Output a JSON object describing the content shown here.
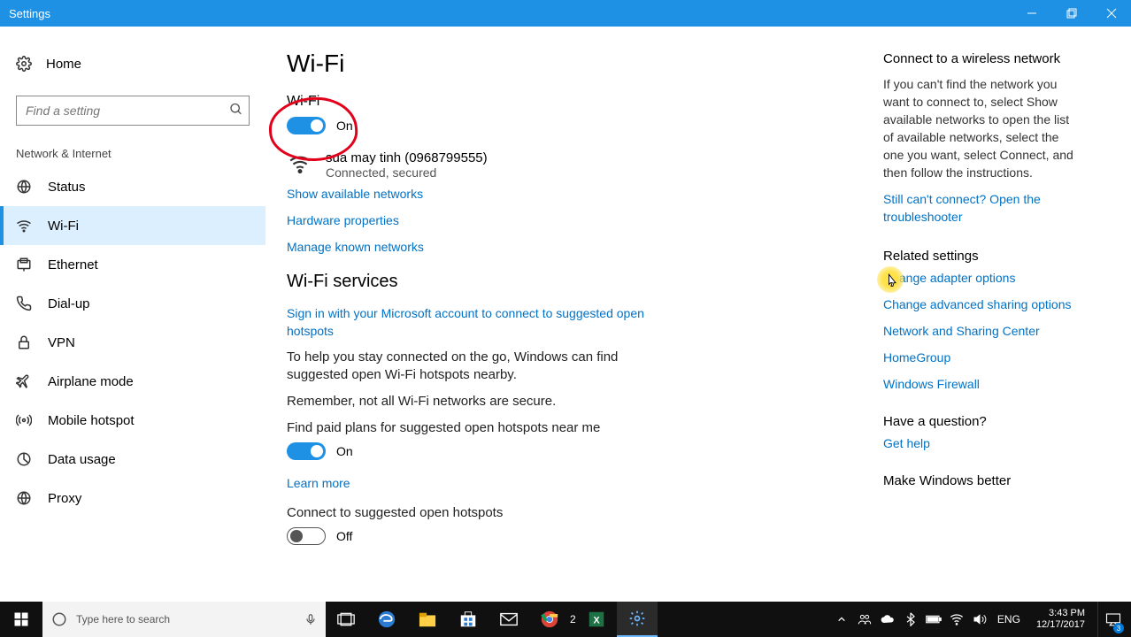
{
  "window": {
    "title": "Settings"
  },
  "sidebar": {
    "home": "Home",
    "search_placeholder": "Find a setting",
    "section": "Network & Internet",
    "items": [
      {
        "id": "status",
        "label": "Status",
        "icon": "status-icon"
      },
      {
        "id": "wifi",
        "label": "Wi-Fi",
        "icon": "wifi-icon",
        "selected": true
      },
      {
        "id": "ethernet",
        "label": "Ethernet",
        "icon": "ethernet-icon"
      },
      {
        "id": "dialup",
        "label": "Dial-up",
        "icon": "dialup-icon"
      },
      {
        "id": "vpn",
        "label": "VPN",
        "icon": "vpn-icon"
      },
      {
        "id": "airplane",
        "label": "Airplane mode",
        "icon": "airplane-icon"
      },
      {
        "id": "hotspot",
        "label": "Mobile hotspot",
        "icon": "hotspot-icon"
      },
      {
        "id": "datausage",
        "label": "Data usage",
        "icon": "datausage-icon"
      },
      {
        "id": "proxy",
        "label": "Proxy",
        "icon": "proxy-icon"
      }
    ]
  },
  "content": {
    "page_title": "Wi-Fi",
    "wifi_label": "Wi-Fi",
    "wifi_state": "On",
    "network_name": "sua may tinh (0968799555)",
    "network_status": "Connected, secured",
    "link_show_networks": "Show available networks",
    "link_hw_props": "Hardware properties",
    "link_manage_known": "Manage known networks",
    "services_heading": "Wi-Fi services",
    "link_signin": "Sign in with your Microsoft account to connect to suggested open hotspots",
    "para_help": "To help you stay connected on the go, Windows can find suggested open Wi-Fi hotspots nearby.",
    "para_remember": "Remember, not all Wi-Fi networks are secure.",
    "paid_plans_label": "Find paid plans for suggested open hotspots near me",
    "paid_plans_state": "On",
    "learn_more": "Learn more",
    "suggested_label": "Connect to suggested open hotspots",
    "suggested_state": "Off"
  },
  "aside": {
    "connect_heading": "Connect to a wireless network",
    "connect_body": "If you can't find the network you want to connect to, select Show available networks to open the list of available networks, select the one you want, select Connect, and then follow the instructions.",
    "troubleshoot": "Still can't connect? Open the troubleshooter",
    "related_heading": "Related settings",
    "links": {
      "adapter": "Change adapter options",
      "sharing": "Change advanced sharing options",
      "center": "Network and Sharing Center",
      "homegroup": "HomeGroup",
      "firewall": "Windows Firewall"
    },
    "question_heading": "Have a question?",
    "get_help": "Get help",
    "feedback_heading": "Make Windows better"
  },
  "taskbar": {
    "search_placeholder": "Type here to search",
    "lang": "ENG",
    "time": "3:43 PM",
    "date": "12/17/2017",
    "notif_count": "3"
  }
}
